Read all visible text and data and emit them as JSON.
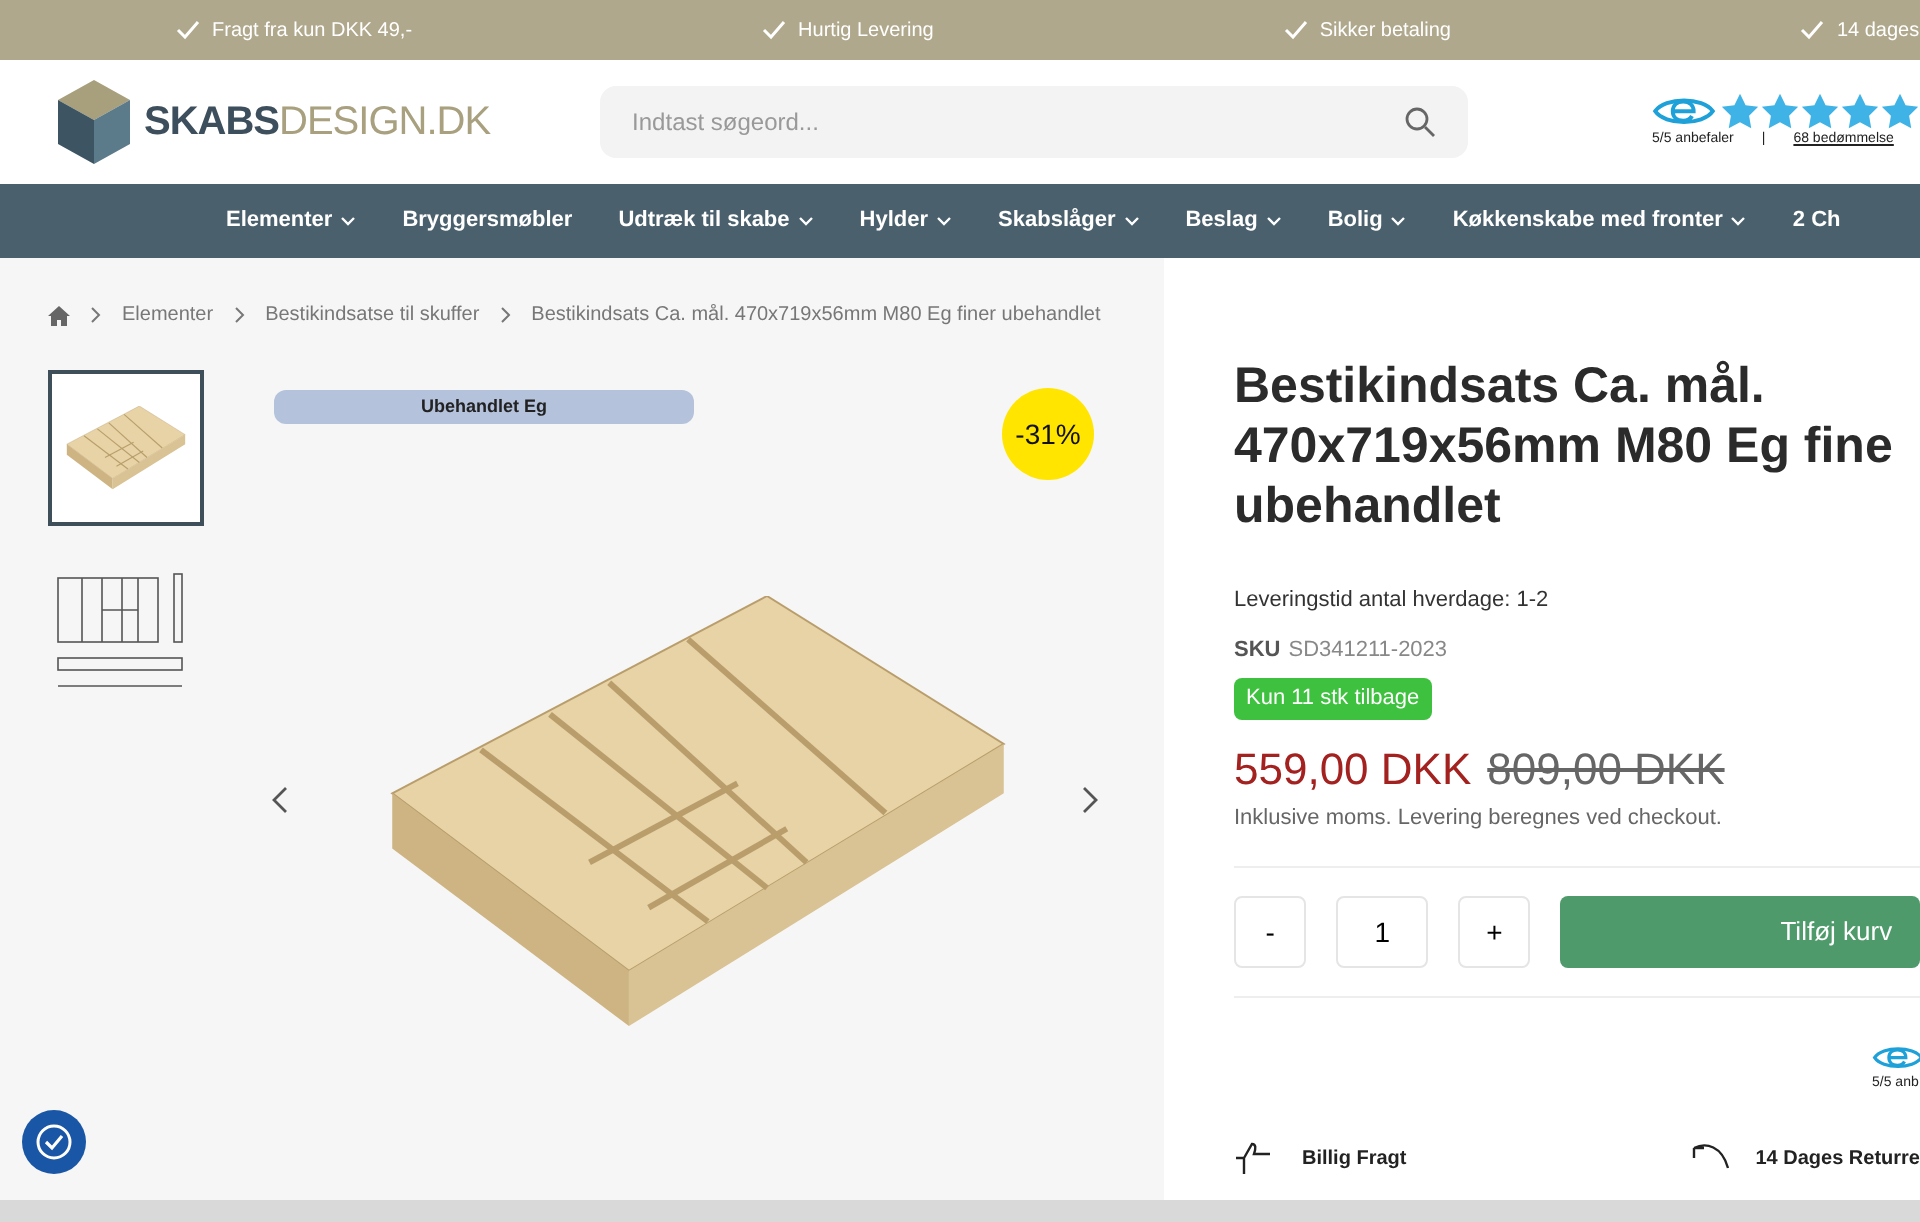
{
  "usp_bar": [
    "Fragt fra kun DKK 49,-",
    "Hurtig Levering",
    "Sikker betaling",
    "14 dages"
  ],
  "header": {
    "logo": "**SKABS**DESIGN.DK",
    "search": {
      "placeholder": "Indtast søgeord..."
    },
    "rating": {
      "stars": 5,
      "recommend": "5/5 anbefaler",
      "separator": "|",
      "reviews": "68 bedømmelse"
    }
  },
  "nav": [
    {
      "label": "Elementer",
      "dropdown": true
    },
    {
      "label": "Bryggersmøbler",
      "dropdown": false
    },
    {
      "label": "Udtræk til skabe",
      "dropdown": true
    },
    {
      "label": "Hylder",
      "dropdown": true
    },
    {
      "label": "Skabslåger",
      "dropdown": true
    },
    {
      "label": "Beslag",
      "dropdown": true
    },
    {
      "label": "Bolig",
      "dropdown": true
    },
    {
      "label": "Køkkenskabe med fronter",
      "dropdown": true
    },
    {
      "label": "2 Ch",
      "dropdown": false
    }
  ],
  "breadcrumbs": [
    "Elementer",
    "Bestikindsatse til skuffer",
    "Bestikindsats Ca. mål. 470x719x56mm M80 Eg finer ubehandlet"
  ],
  "gallery": {
    "thumbnails": [
      {
        "kind": "photo",
        "selected": true
      },
      {
        "kind": "sketch",
        "selected": false
      }
    ],
    "tag": "Ubehandlet Eg",
    "discount": "-31%"
  },
  "product": {
    "title_lines": [
      "Bestikindsats Ca. mål.",
      "470x719x56mm M80 Eg fine",
      "ubehandlet"
    ],
    "delivery": "Leveringstid antal hverdage: 1-2",
    "sku_label": "SKU",
    "sku": "SD341211-2023",
    "stock": "Kun 11 stk tilbage",
    "price": "559,00 DKK",
    "old_price": "809,00 DKK",
    "price_note": "Inklusive moms. Levering beregnes ved checkout.",
    "qty_minus": "-",
    "qty": "1",
    "qty_plus": "+",
    "add_to_cart": "Tilføj kurv",
    "trust_label": "5/5 anb",
    "features": [
      {
        "kind": "thumb",
        "label": "Billig Fragt"
      },
      {
        "kind": "return",
        "label": "14 Dages Returre"
      }
    ]
  }
}
